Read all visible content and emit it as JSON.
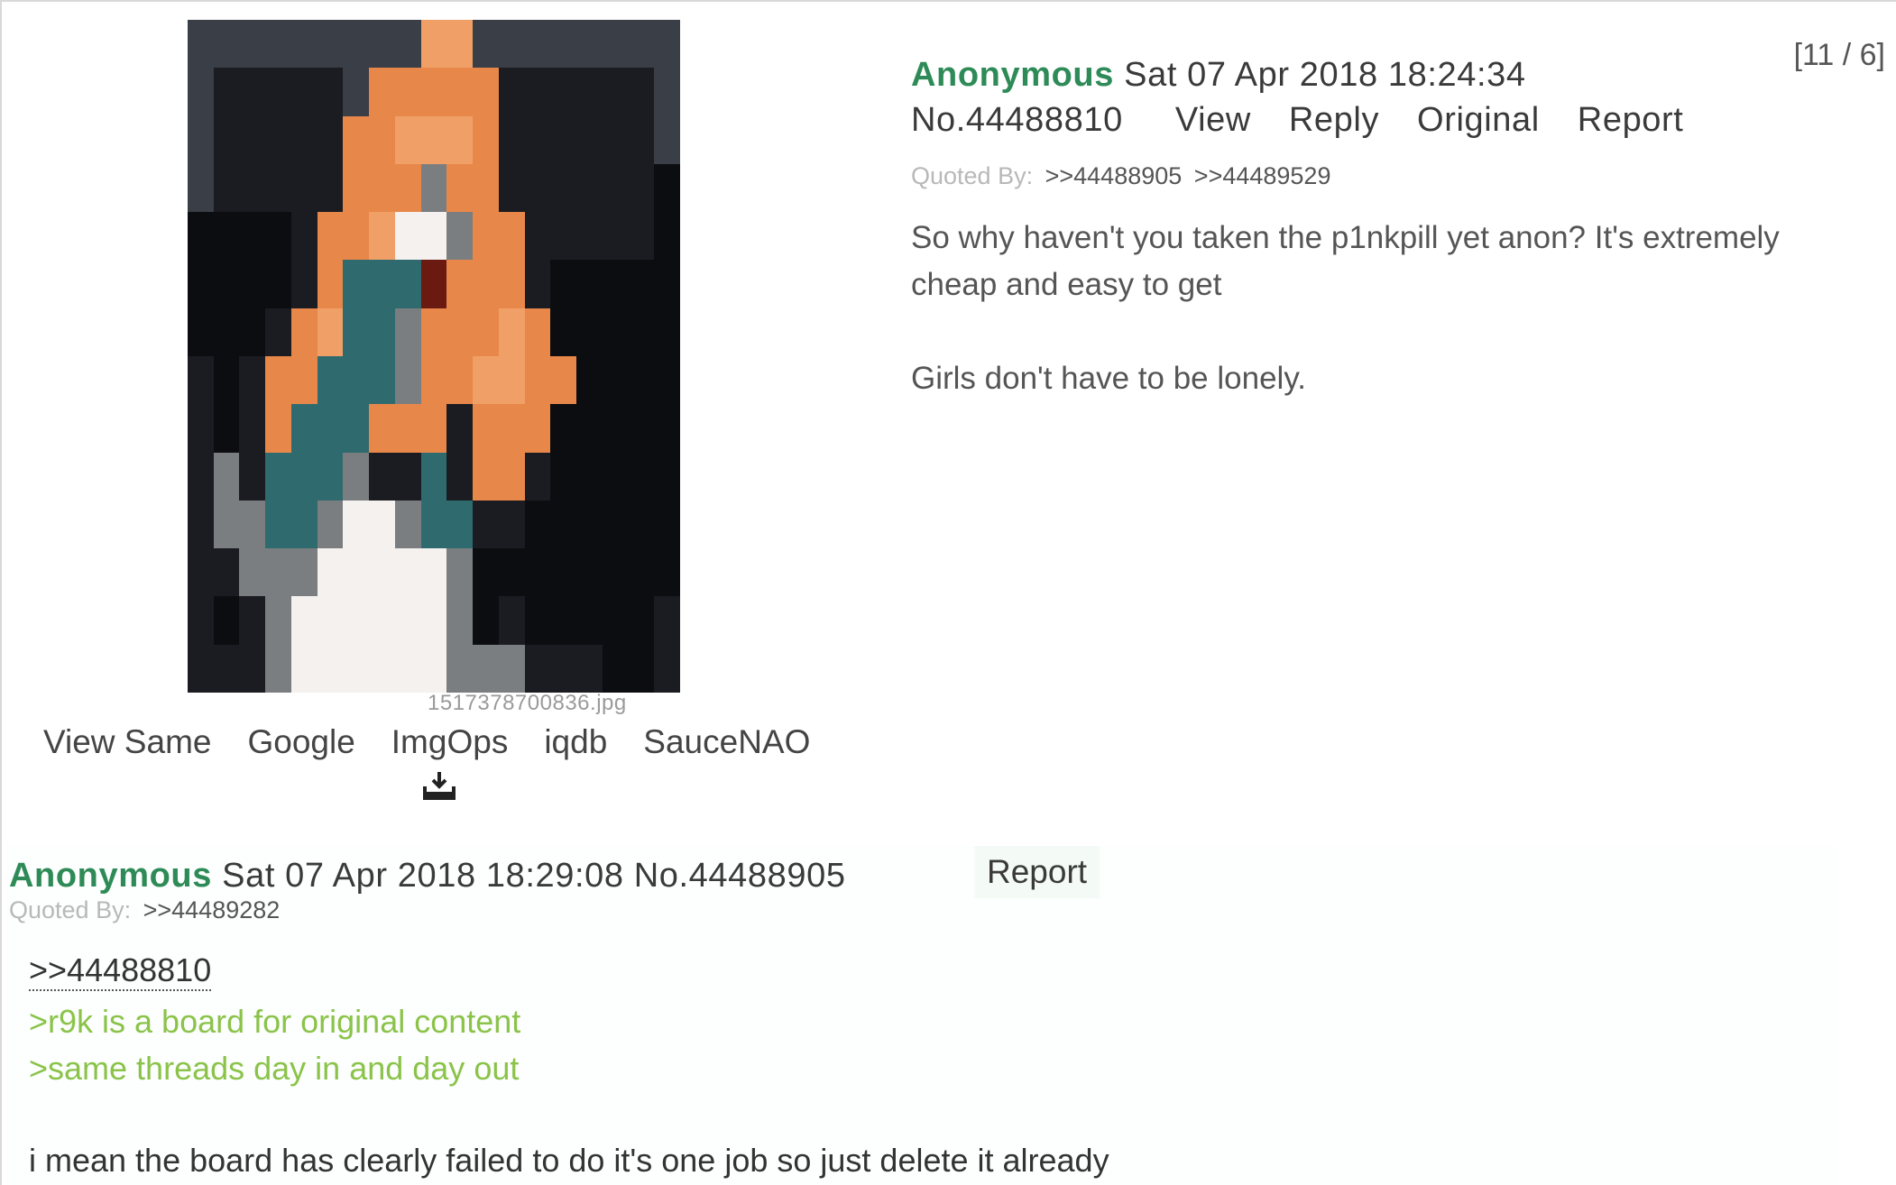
{
  "op": {
    "name": "Anonymous",
    "datetime": "Sat 07 Apr 2018 18:24:34",
    "number": "No.44488810",
    "counter": "[11 / 6]",
    "links": [
      "View",
      "Reply",
      "Original",
      "Report"
    ],
    "quoted_by_label": "Quoted By:",
    "quoted_by": [
      ">>44488905",
      ">>44489529"
    ],
    "body_line1": "So why haven't you taken the p1nkpill yet anon? It's extremely cheap and easy to get",
    "body_line2": "Girls don't have to be lonely.",
    "image": {
      "filename": "1517378700836.jpg",
      "search_links": [
        "View Same",
        "Google",
        "ImgOps",
        "iqdb",
        "SauceNAO"
      ],
      "download_icon": "download-icon"
    }
  },
  "reply": {
    "name": "Anonymous",
    "datetime": "Sat 07 Apr 2018 18:29:08",
    "number": "No.44488905",
    "report_label": "Report",
    "quoted_by_label": "Quoted By:",
    "quoted_by": [
      ">>44489282"
    ],
    "quotelink": ">>44488810",
    "greentext": [
      ">r9k is a board for original content",
      ">same threads day in and day out"
    ],
    "text": "i mean the board has clearly failed to do it's one job so just delete it already"
  },
  "colors": {
    "name_green": "#2e8b57",
    "greentext": "#8bc34a",
    "reply_bg": "#fcfffd"
  }
}
